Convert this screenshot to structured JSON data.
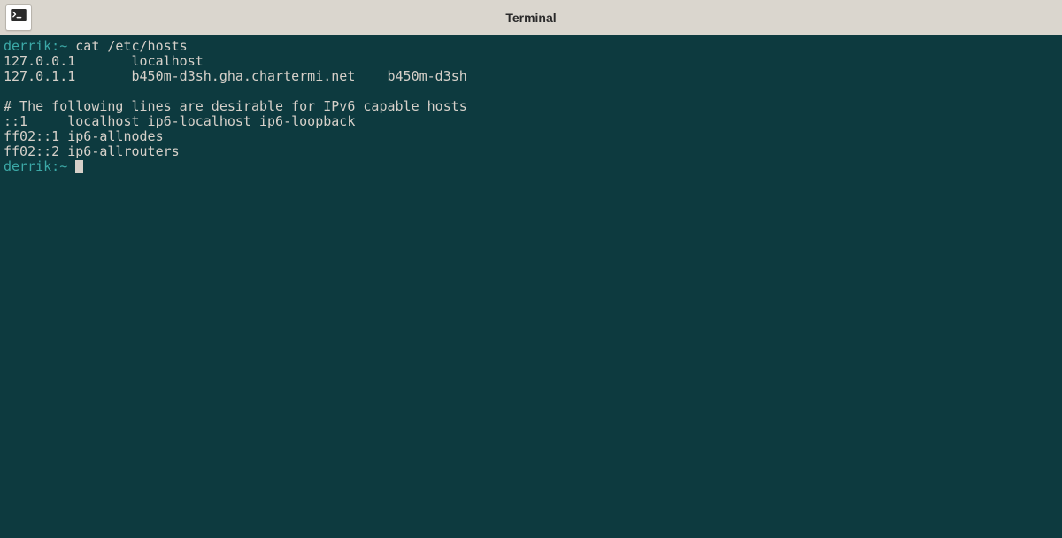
{
  "titlebar": {
    "title": "Terminal"
  },
  "terminal": {
    "prompt1": "derrik:~",
    "command1": " cat /etc/hosts",
    "line1": "127.0.0.1       localhost",
    "line2": "127.0.1.1       b450m-d3sh.gha.chartermi.net    b450m-d3sh",
    "line_blank": "",
    "line3": "# The following lines are desirable for IPv6 capable hosts",
    "line4": "::1     localhost ip6-localhost ip6-loopback",
    "line5": "ff02::1 ip6-allnodes",
    "line6": "ff02::2 ip6-allrouters",
    "prompt2": "derrik:~ "
  }
}
